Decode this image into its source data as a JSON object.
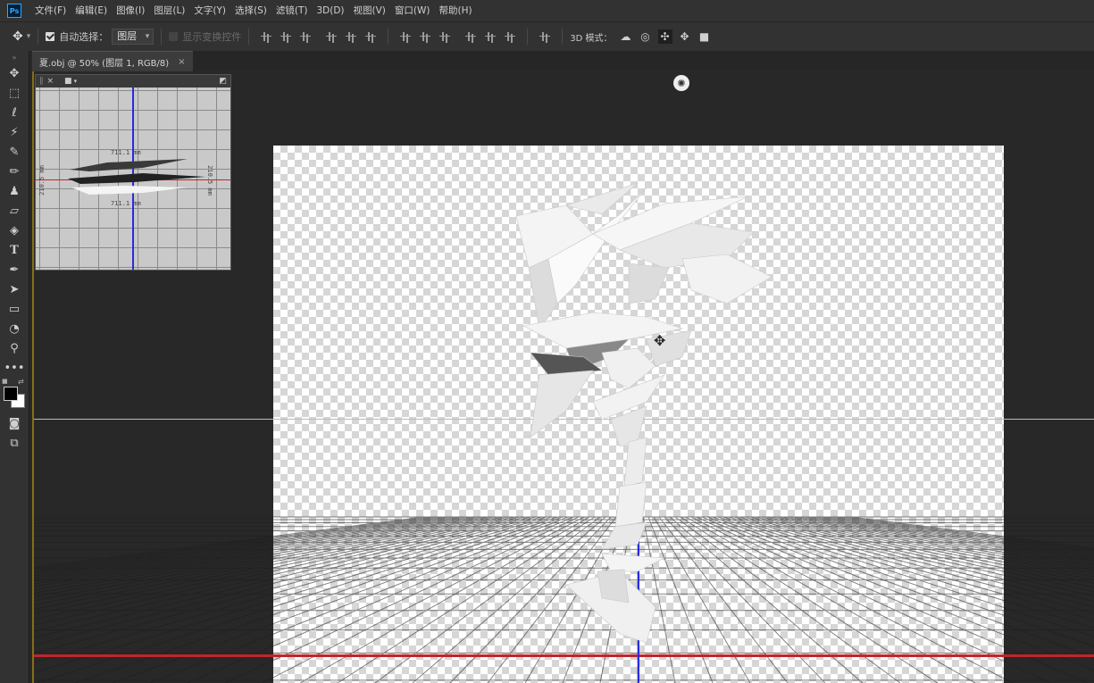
{
  "app": {
    "logo": "Ps"
  },
  "menu": [
    "文件(F)",
    "编辑(E)",
    "图像(I)",
    "图层(L)",
    "文字(Y)",
    "选择(S)",
    "滤镜(T)",
    "3D(D)",
    "视图(V)",
    "窗口(W)",
    "帮助(H)"
  ],
  "options": {
    "auto_select_label": "自动选择：",
    "auto_select_value": "图层",
    "show_transform_label": "显示变换控件",
    "mode3d_label": "3D 模式："
  },
  "document": {
    "tab_title": "夏.obj @ 50% (图层 1, RGB/8)",
    "close": "×"
  },
  "camera_view": {
    "close": "×",
    "measure_top": "711.1 mm",
    "measure_bottom": "711.1 mm",
    "measure_left": "210.5 mm",
    "measure_right": "210.5 mm"
  },
  "colors": {
    "accent_red": "#c0252a",
    "axis_blue": "#2a2ae0",
    "ps_blue": "#31a8ff"
  },
  "icons": {
    "tools": [
      "move-icon",
      "marquee-icon",
      "lasso-icon",
      "magic-wand-icon",
      "eyedropper-icon",
      "brush-icon",
      "stamp-icon",
      "eraser-icon",
      "paint-bucket-icon",
      "type-icon",
      "pen-icon",
      "path-select-icon",
      "shape-icon",
      "3d-rotate-icon",
      "zoom-icon",
      "more-icon"
    ]
  }
}
